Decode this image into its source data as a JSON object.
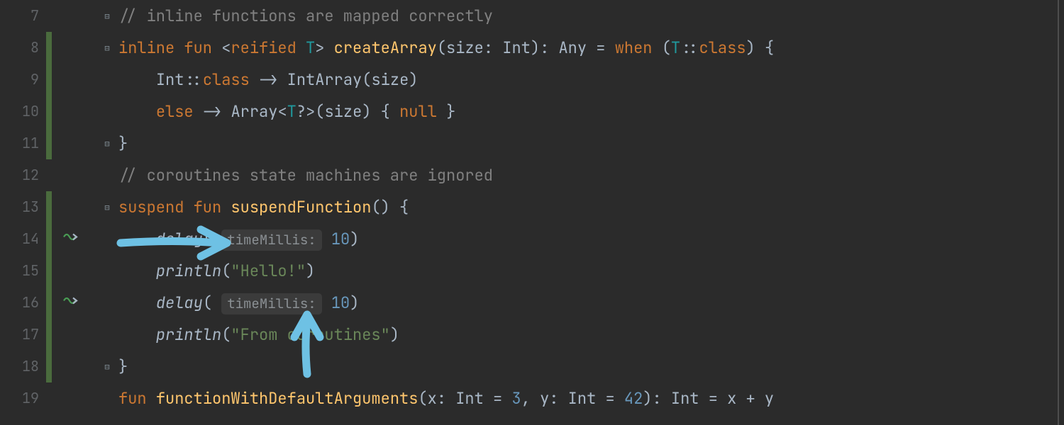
{
  "lines": {
    "l7": "7",
    "l8": "8",
    "l9": "9",
    "l10": "10",
    "l11": "11",
    "l12": "12",
    "l13": "13",
    "l14": "14",
    "l15": "15",
    "l16": "16",
    "l17": "17",
    "l18": "18",
    "l19": "19"
  },
  "fold": {
    "open": "⊟",
    "close": "⊟"
  },
  "icon": {
    "suspend": "⤳"
  },
  "c7": {
    "cmt": "// inline functions are mapped correctly"
  },
  "c8": {
    "inline": "inline",
    "fun": "fun",
    "lt": "<",
    "reified": "reified",
    "sp": " ",
    "T": "T",
    "gt": ">",
    "fn": "createArray",
    "lp": "(",
    "pSize": "size",
    "colon": ": ",
    "Int": "Int",
    "rp": ")",
    "retColon": ": ",
    "Any": "Any",
    "eq": " = ",
    "when": "when",
    "sp2": " (",
    "T2": "T",
    "clref": "::",
    "class": "class",
    "rp2": ") {"
  },
  "c9": {
    "Int": "Int",
    "clref": "::",
    "class": "class",
    "arrow": " -> ",
    "IntArray": "IntArray",
    "lp": "(",
    "size": "size",
    "rp": ")"
  },
  "c10": {
    "else": "else",
    "arrow": " -> ",
    "Array": "Array",
    "lt": "<",
    "T": "T",
    "q": "?",
    "gt": ">",
    "lp": "(",
    "size": "size",
    "rp": ") { ",
    "null": "null",
    "end": " }"
  },
  "c11": {
    "brace": "}"
  },
  "c12": {
    "cmt": "// coroutines state machines are ignored"
  },
  "c13": {
    "suspend": "suspend",
    "fun": "fun",
    "name": "suspendFunction",
    "parens": "() {"
  },
  "c14": {
    "delay": "delay",
    "lp": "(",
    "hint": "timeMillis:",
    "val": "10",
    "rp": ")"
  },
  "c15": {
    "println": "println",
    "lp": "(",
    "str": "\"Hello!\"",
    "rp": ")"
  },
  "c16": {
    "delay": "delay",
    "lp": "(",
    "hint": "timeMillis:",
    "val": "10",
    "rp": ")"
  },
  "c17": {
    "println": "println",
    "lp": "(",
    "str": "\"From coroutines\"",
    "rp": ")"
  },
  "c18": {
    "brace": "}"
  },
  "c19": {
    "fun": "fun",
    "name": "functionWithDefaultArguments",
    "lp": "(",
    "x": "x",
    "c1": ": ",
    "Int1": "Int",
    "eq1": " = ",
    "v1": "3",
    "com": ", ",
    "y": "y",
    "c2": ": ",
    "Int2": "Int",
    "eq2": " = ",
    "v2": "42",
    "rp": "): ",
    "IntR": "Int",
    "eq3": " = ",
    "expr": "x + y"
  },
  "colors": {
    "annotation": "#6ec1e4"
  }
}
